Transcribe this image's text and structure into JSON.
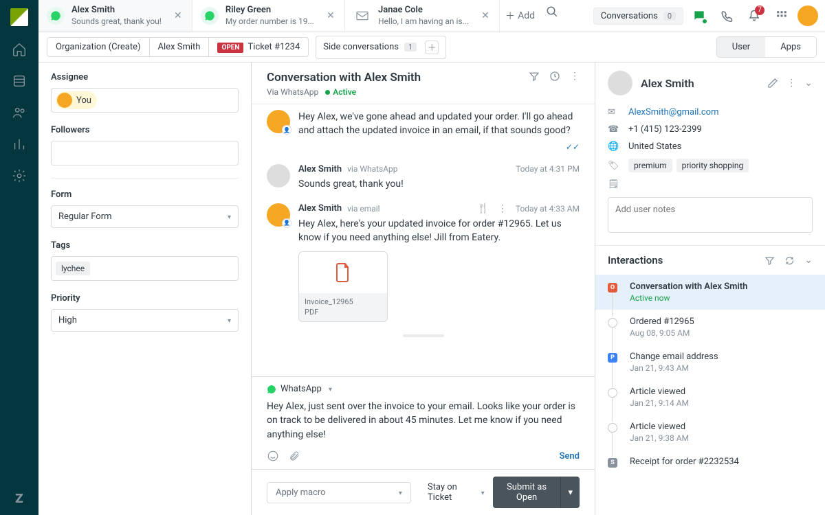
{
  "topbar": {
    "tabs": [
      {
        "title": "Alex Smith",
        "subtitle": "Sounds great, thank you!",
        "channel": "whatsapp"
      },
      {
        "title": "Riley Green",
        "subtitle": "My order number is 19...",
        "channel": "whatsapp"
      },
      {
        "title": "Janae Cole",
        "subtitle": "Hello, I am having an is...",
        "channel": "email"
      }
    ],
    "add": "Add",
    "conversations": "Conversations",
    "conversations_count": "0",
    "notif_count": "7"
  },
  "subbar": {
    "crumb1": "Organization (Create)",
    "crumb2": "Alex Smith",
    "open": "OPEN",
    "ticket": "Ticket #1234",
    "side": "Side conversations",
    "side_count": "1",
    "seg_user": "User",
    "seg_apps": "Apps"
  },
  "props": {
    "assignee_label": "Assignee",
    "assignee_value": "You",
    "followers_label": "Followers",
    "form_label": "Form",
    "form_value": "Regular Form",
    "tags_label": "Tags",
    "tag_value": "lychee",
    "priority_label": "Priority",
    "priority_value": "High"
  },
  "conversation": {
    "title": "Conversation with Alex Smith",
    "via": "Via WhatsApp",
    "status": "Active",
    "messages": [
      {
        "name": "",
        "via": "",
        "time": "",
        "text": "Hey Alex, we've gone ahead and updated your order. I'll go ahead and attach the updated invoice in an email, if that sounds good?",
        "delivered": true
      },
      {
        "name": "Alex Smith",
        "via": "via WhatsApp",
        "time": "Today at 4:31 PM",
        "text": "Sounds great, thank you!"
      },
      {
        "name": "Alex Smith",
        "via": "via email",
        "time": "Today at 4:33 AM",
        "text": "Hey Alex, here's your updated invoice for order #12965. Let us know if you need anything else! Jill from Eatery.",
        "attachment": {
          "name": "Invoice_12965",
          "type": "PDF"
        }
      }
    ],
    "composer_channel": "WhatsApp",
    "composer_text": "Hey Alex, just sent over the invoice to your email. Looks like your order is on track to be delivered in about 45 minutes. Let me know if you need anything else!",
    "send": "Send",
    "macro": "Apply macro",
    "stay": "Stay on Ticket",
    "submit": "Submit as Open"
  },
  "rpanel": {
    "name": "Alex Smith",
    "email": "AlexSmith@gmail.com",
    "phone": "+1 (415) 123-2399",
    "location": "United States",
    "tags": [
      "premium",
      "priority shopping"
    ],
    "notes_placeholder": "Add user notes",
    "interactions_title": "Interactions",
    "items": [
      {
        "title": "Conversation with Alex Smith",
        "time": "Active now",
        "marker": "o",
        "active": true
      },
      {
        "title": "Ordered #12965",
        "time": "Aug 08, 9:05 AM",
        "marker": "circle"
      },
      {
        "title": "Change email address",
        "time": "Jan 21, 9:43 AM",
        "marker": "p"
      },
      {
        "title": "Article viewed",
        "time": "Jan 21, 9:14 AM",
        "marker": "circle"
      },
      {
        "title": "Article viewed",
        "time": "Jan 21, 9:38 AM",
        "marker": "circle"
      },
      {
        "title": "Receipt for order #2232534",
        "time": "",
        "marker": "s"
      }
    ]
  }
}
